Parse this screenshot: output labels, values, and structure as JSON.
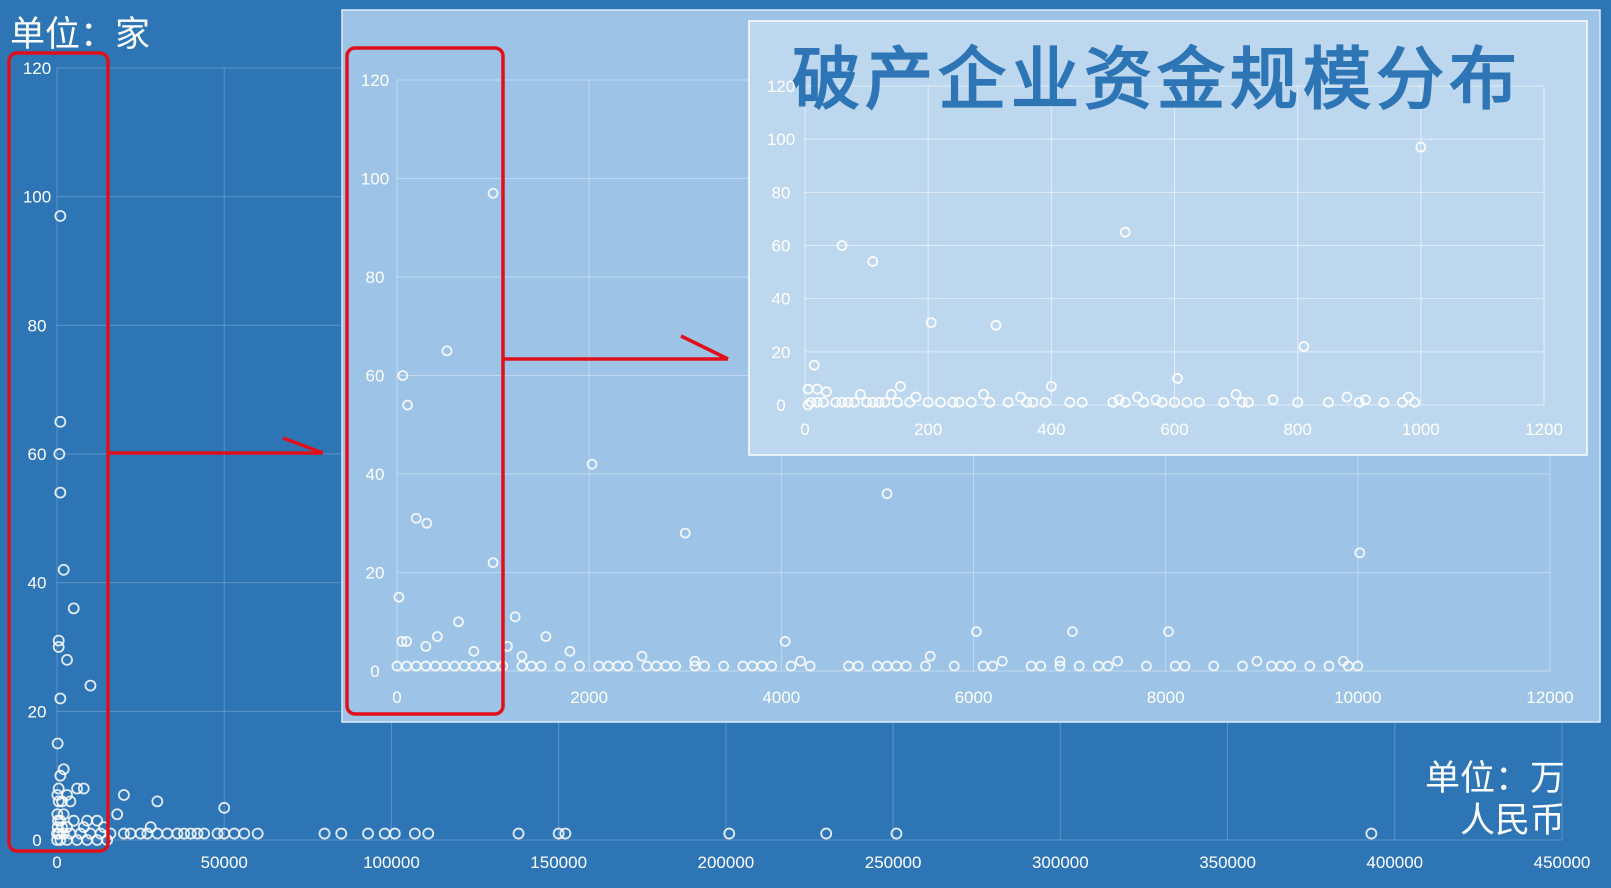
{
  "title": "破产企业资金规模分布",
  "unit_y": "单位：家",
  "unit_x_line1": "单位：万",
  "unit_x_line2": "人民币",
  "colors": {
    "background": "#2E75B6",
    "inset1_panel": "#9DC3E6",
    "inset2_panel": "#BDD7EE",
    "title": "#2E75B6",
    "highlight": "#E0101B",
    "marker": "#FFFFFF"
  },
  "chart_data": [
    {
      "type": "scatter",
      "name": "main",
      "xlim": [
        0,
        450000
      ],
      "ylim": [
        0,
        120
      ],
      "xticks": [
        0,
        50000,
        100000,
        150000,
        200000,
        250000,
        300000,
        350000,
        400000,
        450000
      ],
      "yticks": [
        0,
        20,
        40,
        60,
        80,
        100,
        120
      ],
      "grid": true,
      "points": [
        [
          1000,
          97
        ],
        [
          1000,
          65
        ],
        [
          700,
          60
        ],
        [
          1000,
          54
        ],
        [
          2000,
          42
        ],
        [
          5000,
          36
        ],
        [
          500,
          31
        ],
        [
          500,
          30
        ],
        [
          3000,
          28
        ],
        [
          10000,
          24
        ],
        [
          1000,
          22
        ],
        [
          200,
          15
        ],
        [
          2000,
          11
        ],
        [
          1000,
          10
        ],
        [
          500,
          8
        ],
        [
          6000,
          8
        ],
        [
          8000,
          8
        ],
        [
          100,
          7
        ],
        [
          3000,
          7
        ],
        [
          20000,
          7
        ],
        [
          30000,
          6
        ],
        [
          500,
          6
        ],
        [
          1500,
          6
        ],
        [
          4000,
          6
        ],
        [
          50000,
          5
        ],
        [
          100,
          4
        ],
        [
          2000,
          4
        ],
        [
          18000,
          4
        ],
        [
          300,
          3
        ],
        [
          1000,
          3
        ],
        [
          5000,
          3
        ],
        [
          9000,
          3
        ],
        [
          12000,
          3
        ],
        [
          200,
          2
        ],
        [
          1500,
          2
        ],
        [
          3000,
          2
        ],
        [
          8000,
          2
        ],
        [
          14000,
          2
        ],
        [
          28000,
          2
        ],
        [
          0,
          1
        ],
        [
          500,
          1
        ],
        [
          2000,
          1
        ],
        [
          4000,
          1
        ],
        [
          7000,
          1
        ],
        [
          10000,
          1
        ],
        [
          13000,
          1
        ],
        [
          16000,
          1
        ],
        [
          20000,
          1
        ],
        [
          22000,
          1
        ],
        [
          25000,
          1
        ],
        [
          27000,
          1
        ],
        [
          30000,
          1
        ],
        [
          33000,
          1
        ],
        [
          36000,
          1
        ],
        [
          38000,
          1
        ],
        [
          40000,
          1
        ],
        [
          42000,
          1
        ],
        [
          44000,
          1
        ],
        [
          48000,
          1
        ],
        [
          50000,
          1
        ],
        [
          53000,
          1
        ],
        [
          56000,
          1
        ],
        [
          60000,
          1
        ],
        [
          80000,
          1
        ],
        [
          85000,
          1
        ],
        [
          93000,
          1
        ],
        [
          98000,
          1
        ],
        [
          101000,
          1
        ],
        [
          107000,
          1
        ],
        [
          111000,
          1
        ],
        [
          138000,
          1
        ],
        [
          150000,
          1
        ],
        [
          152000,
          1
        ],
        [
          201000,
          1
        ],
        [
          230000,
          1
        ],
        [
          251000,
          1
        ],
        [
          393000,
          1
        ],
        [
          0,
          0
        ],
        [
          1000,
          0
        ],
        [
          3000,
          0
        ],
        [
          6000,
          0
        ],
        [
          9000,
          0
        ],
        [
          12000,
          0
        ],
        [
          15000,
          0
        ]
      ]
    },
    {
      "type": "scatter",
      "name": "inset-0-12000",
      "xlim": [
        0,
        12000
      ],
      "ylim": [
        0,
        120
      ],
      "xticks": [
        0,
        2000,
        4000,
        6000,
        8000,
        10000,
        12000
      ],
      "yticks": [
        0,
        20,
        40,
        60,
        80,
        100,
        120
      ],
      "grid": true,
      "points": [
        [
          1000,
          97
        ],
        [
          520,
          65
        ],
        [
          60,
          60
        ],
        [
          110,
          54
        ],
        [
          2030,
          42
        ],
        [
          5100,
          36
        ],
        [
          200,
          31
        ],
        [
          310,
          30
        ],
        [
          3000,
          28
        ],
        [
          1000,
          22
        ],
        [
          10020,
          24
        ],
        [
          20,
          15
        ],
        [
          1230,
          11
        ],
        [
          640,
          10
        ],
        [
          420,
          7
        ],
        [
          1550,
          7
        ],
        [
          4040,
          6
        ],
        [
          6030,
          8
        ],
        [
          7030,
          8
        ],
        [
          8030,
          8
        ],
        [
          1150,
          5
        ],
        [
          50,
          6
        ],
        [
          100,
          6
        ],
        [
          300,
          5
        ],
        [
          800,
          4
        ],
        [
          1300,
          3
        ],
        [
          1800,
          4
        ],
        [
          2550,
          3
        ],
        [
          3100,
          2
        ],
        [
          4200,
          2
        ],
        [
          5550,
          3
        ],
        [
          6300,
          2
        ],
        [
          6900,
          2
        ],
        [
          7500,
          2
        ],
        [
          8950,
          2
        ],
        [
          9850,
          2
        ],
        [
          0,
          1
        ],
        [
          100,
          1
        ],
        [
          200,
          1
        ],
        [
          300,
          1
        ],
        [
          400,
          1
        ],
        [
          500,
          1
        ],
        [
          600,
          1
        ],
        [
          700,
          1
        ],
        [
          800,
          1
        ],
        [
          900,
          1
        ],
        [
          1000,
          1
        ],
        [
          1100,
          1
        ],
        [
          1300,
          1
        ],
        [
          1400,
          1
        ],
        [
          1500,
          1
        ],
        [
          1700,
          1
        ],
        [
          1900,
          1
        ],
        [
          2100,
          1
        ],
        [
          2200,
          1
        ],
        [
          2300,
          1
        ],
        [
          2400,
          1
        ],
        [
          2600,
          1
        ],
        [
          2700,
          1
        ],
        [
          2800,
          1
        ],
        [
          2900,
          1
        ],
        [
          3100,
          1
        ],
        [
          3200,
          1
        ],
        [
          3400,
          1
        ],
        [
          3600,
          1
        ],
        [
          3700,
          1
        ],
        [
          3800,
          1
        ],
        [
          3900,
          1
        ],
        [
          4100,
          1
        ],
        [
          4300,
          1
        ],
        [
          4700,
          1
        ],
        [
          4800,
          1
        ],
        [
          5000,
          1
        ],
        [
          5100,
          1
        ],
        [
          5200,
          1
        ],
        [
          5300,
          1
        ],
        [
          5500,
          1
        ],
        [
          5800,
          1
        ],
        [
          6100,
          1
        ],
        [
          6200,
          1
        ],
        [
          6600,
          1
        ],
        [
          6700,
          1
        ],
        [
          6900,
          1
        ],
        [
          7100,
          1
        ],
        [
          7300,
          1
        ],
        [
          7400,
          1
        ],
        [
          7800,
          1
        ],
        [
          8100,
          1
        ],
        [
          8200,
          1
        ],
        [
          8500,
          1
        ],
        [
          8800,
          1
        ],
        [
          9100,
          1
        ],
        [
          9200,
          1
        ],
        [
          9300,
          1
        ],
        [
          9500,
          1
        ],
        [
          9700,
          1
        ],
        [
          9900,
          1
        ],
        [
          10000,
          1
        ]
      ]
    },
    {
      "type": "scatter",
      "name": "inset-0-1200",
      "xlim": [
        0,
        1200
      ],
      "ylim": [
        0,
        120
      ],
      "xticks": [
        0,
        200,
        400,
        600,
        800,
        1000,
        1200
      ],
      "yticks": [
        0,
        20,
        40,
        60,
        80,
        100,
        120
      ],
      "grid": true,
      "points": [
        [
          1000,
          97
        ],
        [
          520,
          65
        ],
        [
          60,
          60
        ],
        [
          110,
          54
        ],
        [
          205,
          31
        ],
        [
          310,
          30
        ],
        [
          810,
          22
        ],
        [
          15,
          15
        ],
        [
          605,
          10
        ],
        [
          400,
          7
        ],
        [
          155,
          7
        ],
        [
          20,
          6
        ],
        [
          5,
          6
        ],
        [
          35,
          5
        ],
        [
          90,
          4
        ],
        [
          140,
          4
        ],
        [
          180,
          3
        ],
        [
          290,
          4
        ],
        [
          350,
          3
        ],
        [
          510,
          2
        ],
        [
          540,
          3
        ],
        [
          570,
          2
        ],
        [
          700,
          4
        ],
        [
          760,
          2
        ],
        [
          880,
          3
        ],
        [
          910,
          2
        ],
        [
          980,
          3
        ],
        [
          10,
          1
        ],
        [
          20,
          1
        ],
        [
          30,
          1
        ],
        [
          50,
          1
        ],
        [
          60,
          1
        ],
        [
          70,
          1
        ],
        [
          80,
          1
        ],
        [
          100,
          1
        ],
        [
          110,
          1
        ],
        [
          120,
          1
        ],
        [
          130,
          1
        ],
        [
          150,
          1
        ],
        [
          170,
          1
        ],
        [
          200,
          1
        ],
        [
          220,
          1
        ],
        [
          240,
          1
        ],
        [
          250,
          1
        ],
        [
          270,
          1
        ],
        [
          300,
          1
        ],
        [
          330,
          1
        ],
        [
          360,
          1
        ],
        [
          370,
          1
        ],
        [
          390,
          1
        ],
        [
          430,
          1
        ],
        [
          450,
          1
        ],
        [
          500,
          1
        ],
        [
          520,
          1
        ],
        [
          550,
          1
        ],
        [
          580,
          1
        ],
        [
          600,
          1
        ],
        [
          620,
          1
        ],
        [
          640,
          1
        ],
        [
          680,
          1
        ],
        [
          710,
          1
        ],
        [
          720,
          1
        ],
        [
          800,
          1
        ],
        [
          850,
          1
        ],
        [
          900,
          1
        ],
        [
          940,
          1
        ],
        [
          970,
          1
        ],
        [
          990,
          1
        ],
        [
          5,
          0
        ]
      ]
    }
  ]
}
